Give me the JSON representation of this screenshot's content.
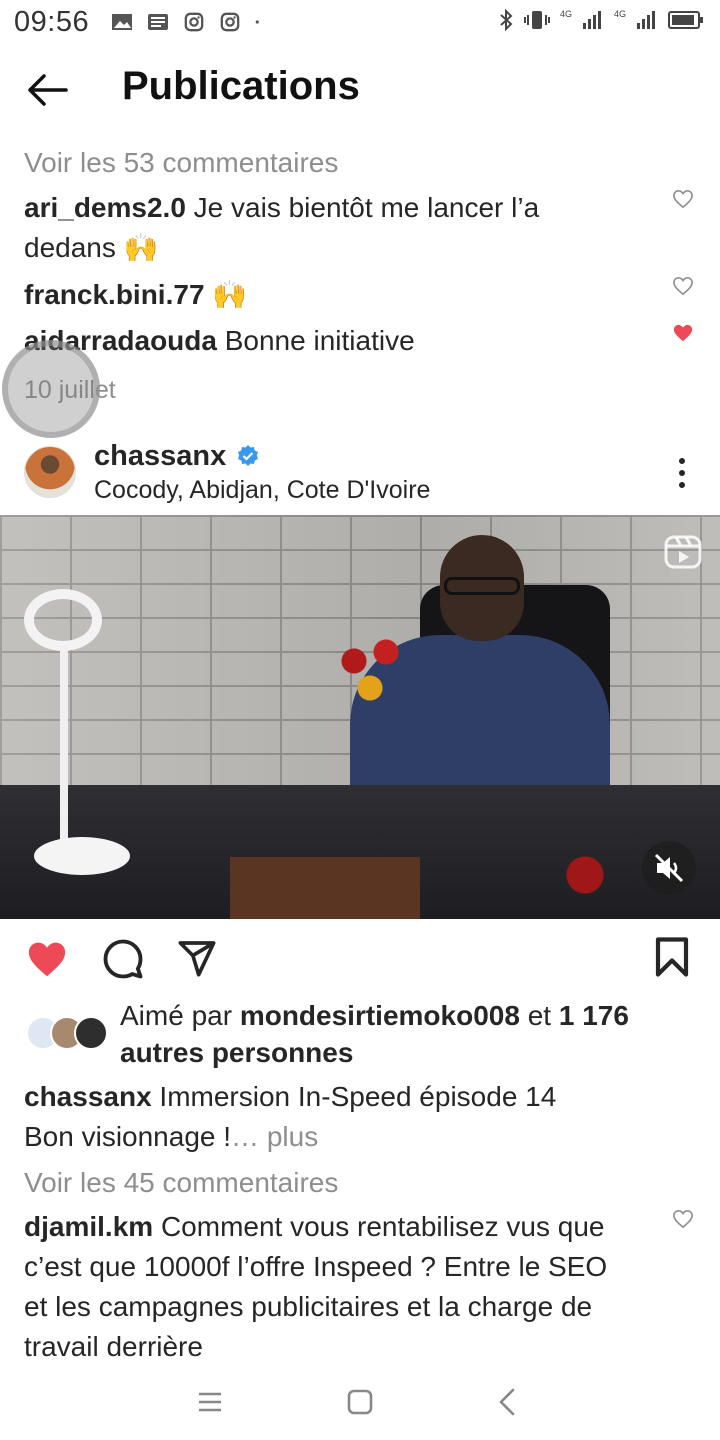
{
  "status_bar": {
    "time": "09:56",
    "network_1": "4G",
    "network_2": "4G",
    "icons": [
      "gallery-icon",
      "news-icon",
      "instagram-icon",
      "instagram-icon",
      "dot-icon",
      "bluetooth-icon",
      "vibrate-icon",
      "signal-icon",
      "signal-icon",
      "battery-icon"
    ]
  },
  "header": {
    "title": "Publications",
    "back_icon": "arrow-left-icon"
  },
  "previous_post": {
    "view_comments": "Voir les 53 commentaires",
    "comments": [
      {
        "user": "ari_dems2.0",
        "text_line1": " Je vais bientôt me lancer l’a",
        "text_line2": "dedans 🙌",
        "liked": false
      },
      {
        "user": "franck.bini.77",
        "text_line1": " 🙌",
        "liked": false
      },
      {
        "user": "aidarradaouda",
        "text_line1": " Bonne initiative",
        "liked": true
      }
    ],
    "date": "10 juillet"
  },
  "post": {
    "username": "chassanx",
    "location": "Cocody, Abidjan, Cote D'Ivoire",
    "liked": true,
    "likes_line1_prefix": "Aimé par ",
    "likes_user": "mondesirtiemoko008",
    "likes_mid": " et ",
    "likes_count": "1 176",
    "likes_line2": "autres personnes",
    "caption_user": "chassanx",
    "caption_line1": " Immersion In-Speed  épisode 14",
    "caption_line2": "Bon visionnage !",
    "caption_more": "… plus",
    "view_comments": "Voir les 45 commentaires",
    "comment": {
      "user": "djamil.km",
      "line1": " Comment vous rentabilisez vus que",
      "line2": "c’est que 10000f l’offre Inspeed ? Entre le SEO",
      "line3": "et les campagnes publicitaires et la charge de",
      "line4": "travail derrière"
    }
  },
  "colors": {
    "accent_red": "#ed4956",
    "verified_blue": "#3897f0",
    "muted": "#8e8e8e"
  }
}
